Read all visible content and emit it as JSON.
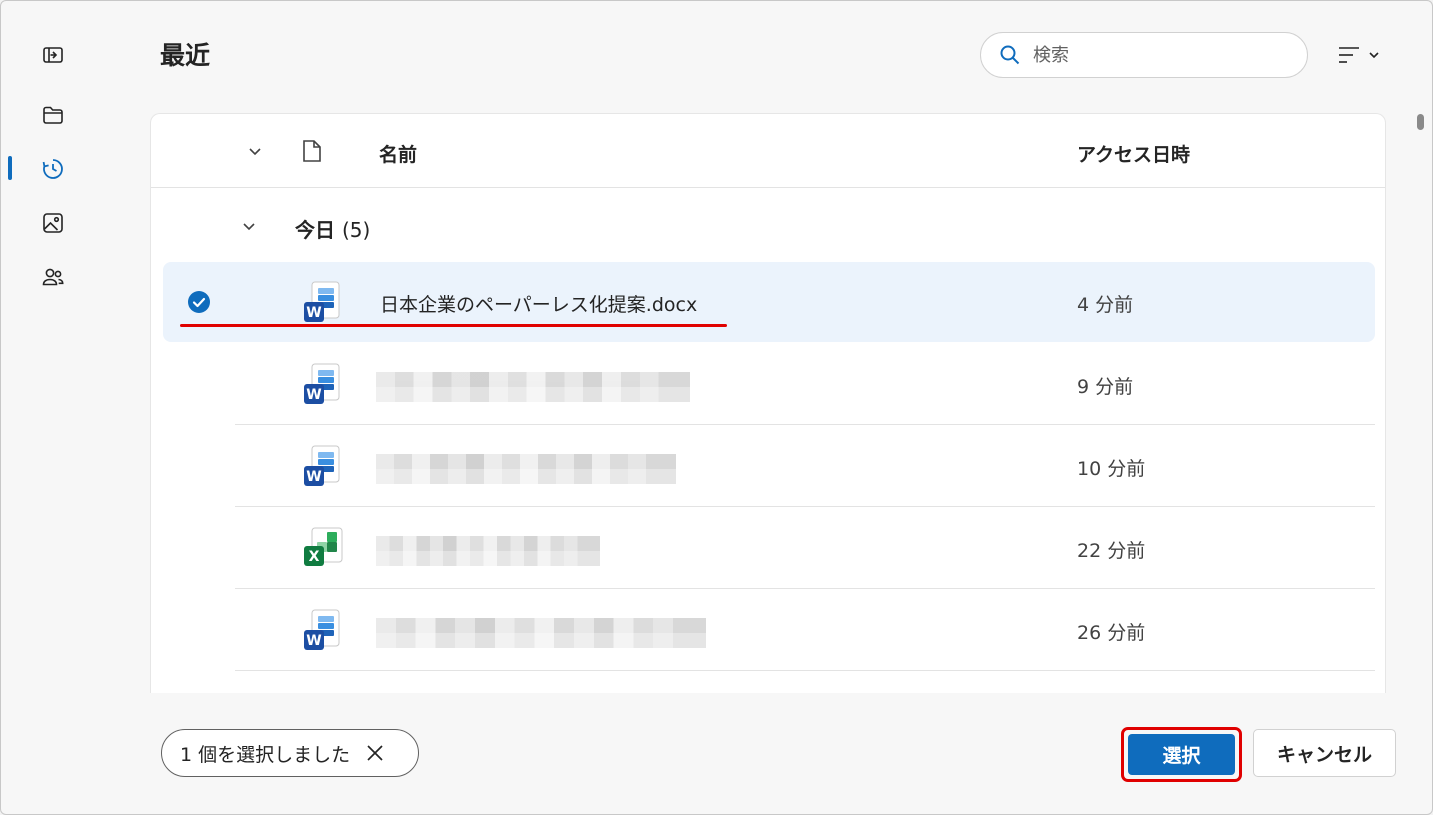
{
  "nav": {
    "items": [
      {
        "icon": "sidebar-expand-icon"
      },
      {
        "icon": "folder-icon"
      },
      {
        "icon": "recent-clock-icon",
        "active": true
      },
      {
        "icon": "image-icon"
      },
      {
        "icon": "people-icon"
      }
    ]
  },
  "header": {
    "title": "最近",
    "search_placeholder": "検索",
    "view_icon": "list-view-icon"
  },
  "table": {
    "col_name": "名前",
    "col_accessed": "アクセス日時"
  },
  "group": {
    "label": "今日",
    "count": "(5)"
  },
  "files": [
    {
      "name": "日本企業のペーパーレス化提案.docx",
      "type": "word",
      "accessed": "4 分前",
      "selected": true
    },
    {
      "name": "",
      "type": "word",
      "accessed": "9 分前",
      "selected": false
    },
    {
      "name": "",
      "type": "word",
      "accessed": "10 分前",
      "selected": false
    },
    {
      "name": "",
      "type": "excel",
      "accessed": "22 分前",
      "selected": false
    },
    {
      "name": "",
      "type": "word",
      "accessed": "26 分前",
      "selected": false
    }
  ],
  "footer": {
    "selected_text": "1 個を選択しました",
    "select_label": "選択",
    "cancel_label": "キャンセル"
  },
  "colors": {
    "accent": "#0f6cbd",
    "highlight_annotation": "#e00000",
    "selected_row": "#ebf3fc"
  }
}
